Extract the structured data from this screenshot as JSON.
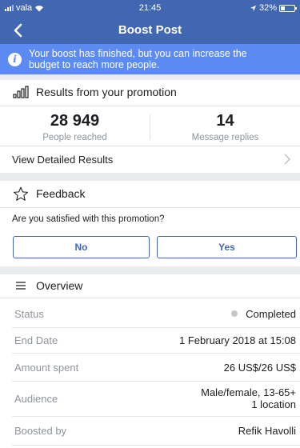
{
  "status_bar": {
    "carrier": "vala",
    "time": "21:45",
    "battery": "32%",
    "battery_level": 0.32
  },
  "nav": {
    "title": "Boost Post"
  },
  "notice": {
    "text_line1": "Your boost has finished, but you can increase the",
    "text_line2": "budget to reach more people.",
    "icon": "i"
  },
  "results": {
    "title": "Results from your promotion",
    "people_reached": "28 949",
    "people_reached_label": "People reached",
    "message_replies": "14",
    "message_replies_label": "Message replies",
    "detailed_link": "View Detailed Results"
  },
  "feedback": {
    "title": "Feedback",
    "question": "Are you satisfied with this promotion?",
    "no_label": "No",
    "yes_label": "Yes"
  },
  "overview": {
    "title": "Overview",
    "status_label": "Status",
    "status_value": "Completed",
    "end_date_label": "End Date",
    "end_date_value": "1 February 2018 at 15:08",
    "amount_label": "Amount spent",
    "amount_value": "26 US$/26 US$",
    "audience_label": "Audience",
    "audience_value_line1": "Male/female, 13-65+",
    "audience_value_line2": "1 location",
    "boosted_label": "Boosted by",
    "boosted_value": "Refik Havolli"
  },
  "colors": {
    "brand": "#4267b2",
    "notice": "#5b8bf2",
    "muted": "#90949c"
  }
}
